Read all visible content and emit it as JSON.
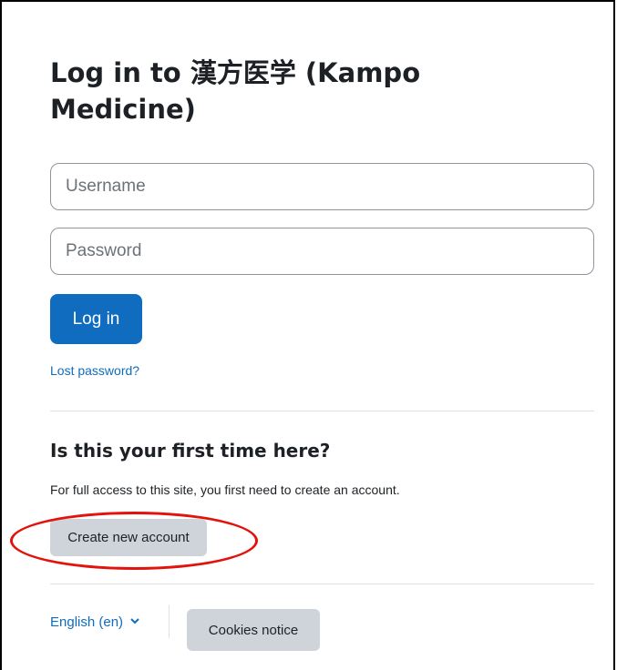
{
  "login": {
    "title": "Log in to 漢方医学 (Kampo Medicine)",
    "username_placeholder": "Username",
    "password_placeholder": "Password",
    "login_button": "Log in",
    "lost_password": "Lost password?"
  },
  "signup": {
    "heading": "Is this your first time here?",
    "info": "For full access to this site, you first need to create an account.",
    "create_button": "Create new account"
  },
  "footer": {
    "language": "English (en)",
    "cookies_button": "Cookies notice"
  },
  "colors": {
    "primary": "#0f6cbf",
    "secondary_button": "#ced4da",
    "highlight": "#e3120b"
  },
  "icons": {
    "language_chevron": "chevron-down-icon"
  }
}
